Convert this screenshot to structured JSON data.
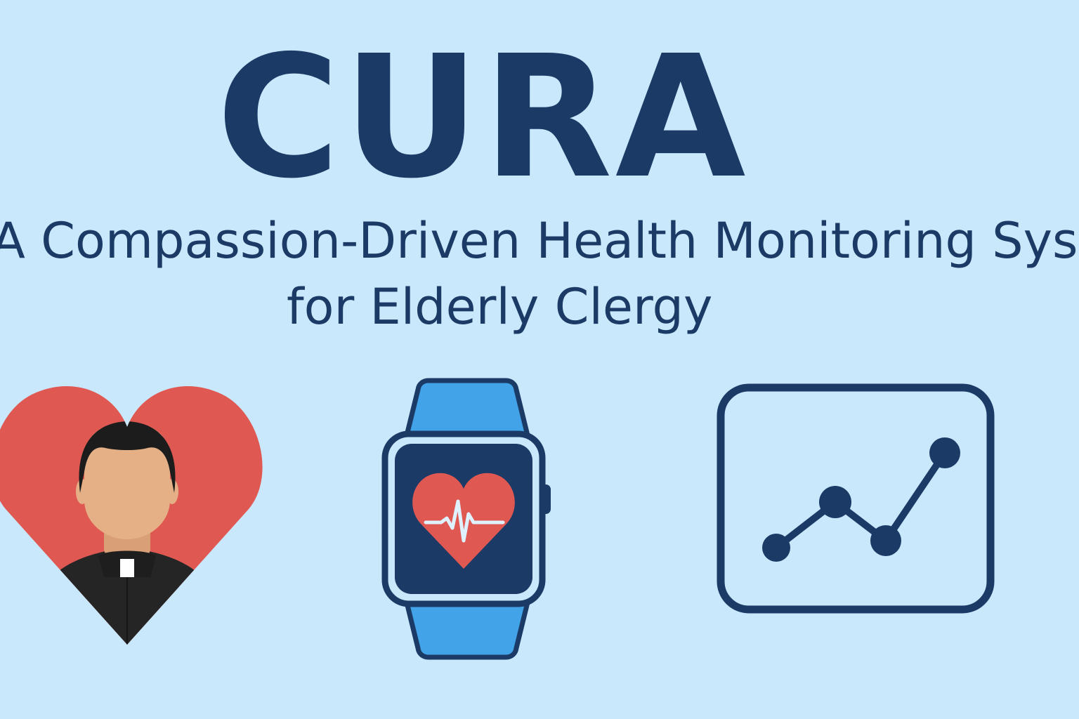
{
  "title": "CURA",
  "subtitle": {
    "line1": "A Compassion-Driven Health Monitoring System",
    "line2": "for Elderly Clergy"
  },
  "icons": [
    "heart-clergy-icon",
    "smartwatch-heartbeat-icon",
    "trend-chart-icon"
  ],
  "colors": {
    "background": "#cae8fc",
    "navy": "#1b3a66",
    "heart_red": "#e05852",
    "watch_band_blue": "#43a3e8",
    "skin": "#e6b086",
    "cassock_black": "#252525",
    "hair_black": "#1c1c1c",
    "collar_white": "#ffffff"
  }
}
